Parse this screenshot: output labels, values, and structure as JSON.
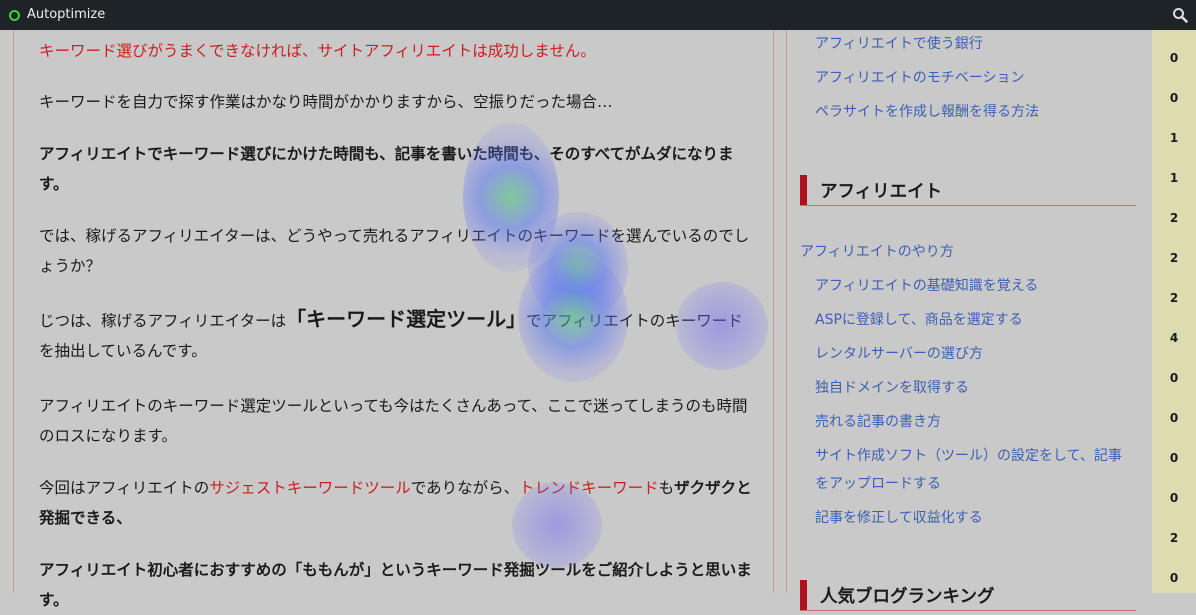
{
  "topbar": {
    "title": "Autoptimize",
    "status_icon": "status-dot-green",
    "search_icon": "search-icon"
  },
  "article": {
    "p1": "キーワード選びがうまくできなければ、サイトアフィリエイトは成功しません。",
    "p2": "キーワードを自力で探す作業はかなり時間がかかりますから、空振りだった場合…",
    "p3": "アフィリエイトでキーワード選びにかけた時間も、記事を書いた時間も、そのすべてがムダになります。",
    "p4": "では、稼げるアフィリエイターは、どうやって売れるアフィリエイトのキーワードを選んでいるのでしょうか？",
    "p5_a": "じつは、稼げるアフィリエイターは",
    "p5_b": "「キーワード選定ツール」",
    "p5_c": "でアフィリエイトのキーワードを抽出しているんです。",
    "p6": "アフィリエイトのキーワード選定ツールといっても今はたくさんあって、ここで迷ってしまうのも時間のロスになります。",
    "p7_a": "今回はアフィリエイトの",
    "p7_b": "サジェストキーワードツール",
    "p7_c": "でありながら、",
    "p7_d": "トレンドキーワード",
    "p7_e": "も",
    "p7_f": "ザクザクと発掘できる、",
    "p8": "アフィリエイト初心者におすすめの「ももんが」というキーワード発掘ツールをご紹介しようと思います。"
  },
  "sidebar": {
    "links_top": [
      "アフィリエイトで使う銀行",
      "アフィリエイトのモチベーション",
      "ペラサイトを作成し報酬を得る方法"
    ],
    "heading1": "アフィリエイト",
    "category": "アフィリエイトのやり方",
    "links_main": [
      "アフィリエイトの基礎知識を覚える",
      "ASPに登録して、商品を選定する",
      "レンタルサーバーの選び方",
      "独自ドメインを取得する",
      "売れる記事の書き方",
      "サイト作成ソフト（ツール）の設定をして、記事",
      "をアップロードする",
      "記事を修正して収益化する"
    ],
    "heading2": "人気ブログランキング"
  },
  "numbers": [
    "0",
    "0",
    "1",
    "1",
    "2",
    "2",
    "2",
    "4",
    "0",
    "0",
    "0",
    "0",
    "2",
    "0"
  ]
}
